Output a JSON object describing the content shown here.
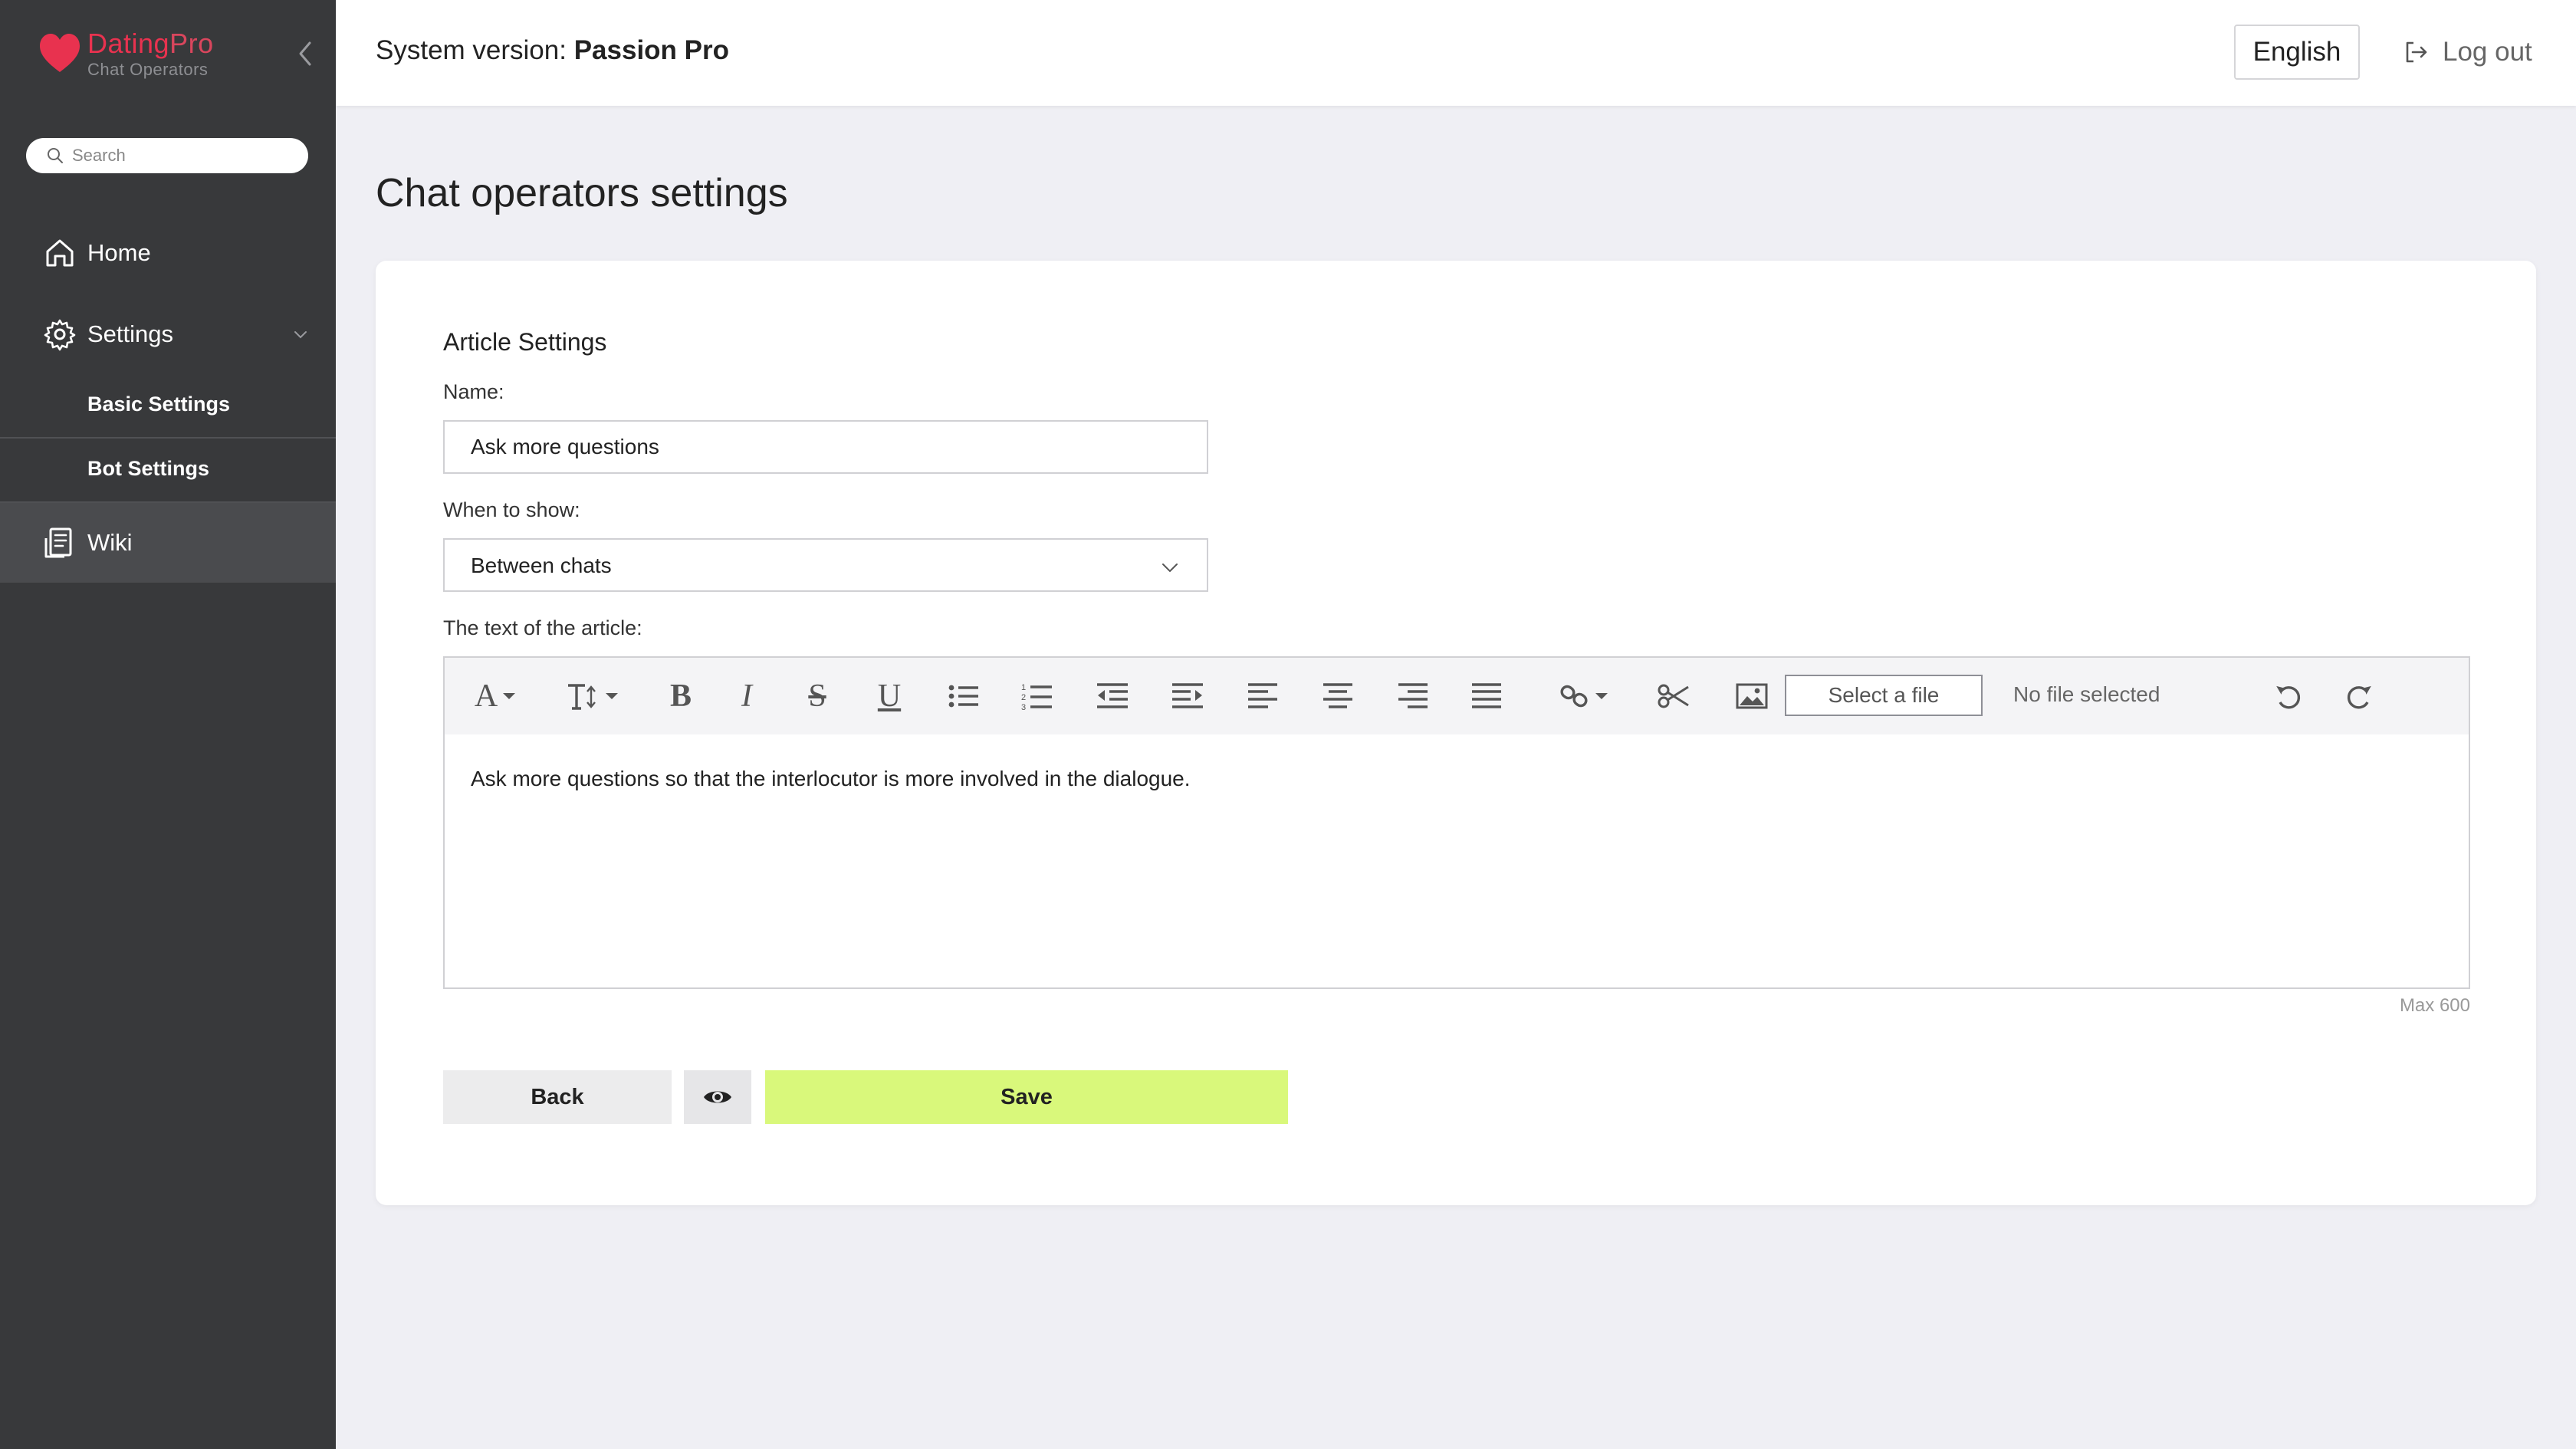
{
  "sidebar": {
    "logo": {
      "brand": "Dating",
      "brand_suffix": "Pro",
      "subtitle": "Chat Operators"
    },
    "search_placeholder": "Search",
    "items": [
      {
        "label": "Home",
        "icon": "home-icon"
      },
      {
        "label": "Settings",
        "icon": "gear-icon",
        "expanded": true,
        "children": [
          {
            "label": "Basic Settings"
          },
          {
            "label": "Bot Settings"
          }
        ]
      },
      {
        "label": "Wiki",
        "icon": "wiki-icon",
        "active": true
      }
    ]
  },
  "header": {
    "version_label": "System version:",
    "version_value": "Passion Pro",
    "language": "English",
    "logout": "Log out"
  },
  "page": {
    "title": "Chat operators settings"
  },
  "form": {
    "section_title": "Article Settings",
    "name_label": "Name:",
    "name_value": "Ask more questions",
    "when_label": "When to show:",
    "when_value": "Between chats",
    "text_label": "The text of the article:",
    "editor": {
      "select_file": "Select a file",
      "no_file": "No file selected",
      "content": "Ask more questions so that the interlocutor is more involved in the dialogue.",
      "max_note": "Max 600"
    },
    "buttons": {
      "back": "Back",
      "save": "Save"
    }
  },
  "colors": {
    "sidebar_bg": "#38393b",
    "brand": "#e8324f",
    "save_bg": "#d9f87b",
    "page_bg": "#efeff4"
  }
}
